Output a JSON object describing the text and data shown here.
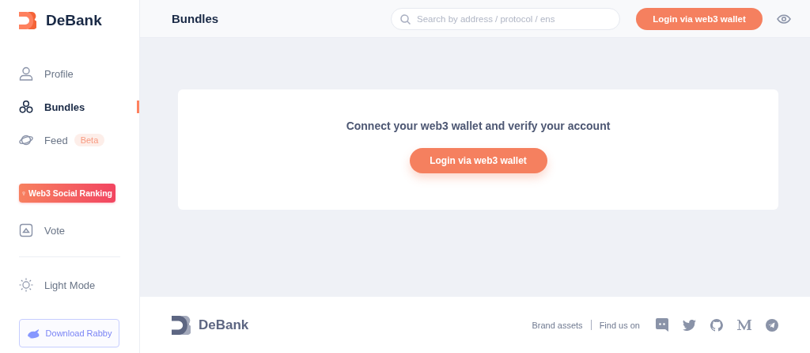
{
  "sidebar": {
    "logo": "DeBank",
    "nav": [
      {
        "label": "Profile",
        "selected": false
      },
      {
        "label": "Bundles",
        "selected": true
      },
      {
        "label": "Feed",
        "selected": false,
        "badge": "Beta"
      }
    ],
    "ranking_button": "Web3 Social Ranking",
    "vote": "Vote",
    "theme_toggle": "Light Mode",
    "download_button": "Download Rabby"
  },
  "header": {
    "title": "Bundles",
    "search": {
      "placeholder": "Search by address / protocol / ens"
    },
    "login_button": "Login via web3 wallet"
  },
  "card": {
    "message": "Connect your web3 wallet and verify your account",
    "login_button": "Login via web3 wallet"
  },
  "footer": {
    "logo": "DeBank",
    "links": [
      "Brand assets",
      "Find us on"
    ]
  }
}
